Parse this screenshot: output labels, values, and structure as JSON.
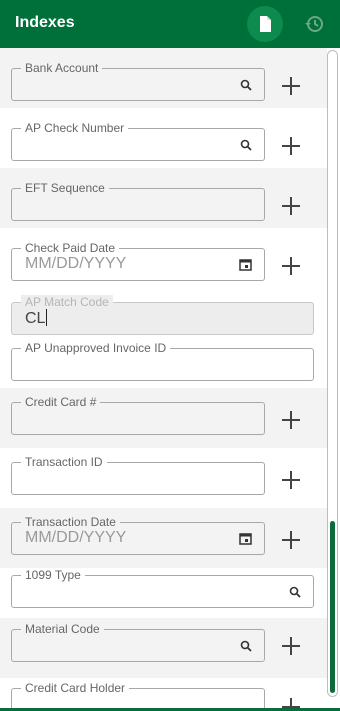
{
  "header": {
    "title": "Indexes",
    "doc_icon": "document-icon",
    "history_icon": "history-icon",
    "bg": "#00703a"
  },
  "fields": [
    {
      "label": "Bank Account",
      "value": "",
      "icon": "search-icon",
      "add": true
    },
    {
      "label": "AP Check Number",
      "value": "",
      "icon": "search-icon",
      "add": true
    },
    {
      "label": "EFT Sequence",
      "value": "",
      "icon": "",
      "add": true
    },
    {
      "label": "Check Paid Date",
      "placeholder": "MM/DD/YYYY",
      "icon": "calendar-icon",
      "add": true
    },
    {
      "label": "AP Match Code",
      "value": "CL",
      "disabled": true
    },
    {
      "label": "AP Unapproved Invoice ID",
      "value": ""
    },
    {
      "label": "Credit Card #",
      "value": "",
      "add": true
    },
    {
      "label": "Transaction ID",
      "value": "",
      "add": true
    },
    {
      "label": "Transaction Date",
      "placeholder": "MM/DD/YYYY",
      "icon": "calendar-icon",
      "add": true
    },
    {
      "label": "1099 Type",
      "value": "",
      "icon": "search-icon"
    },
    {
      "label": "Material Code",
      "value": "",
      "icon": "search-icon",
      "add": true
    },
    {
      "label": "Credit Card Holder",
      "value": "",
      "add": true
    }
  ],
  "accent": "#0d6b3a"
}
